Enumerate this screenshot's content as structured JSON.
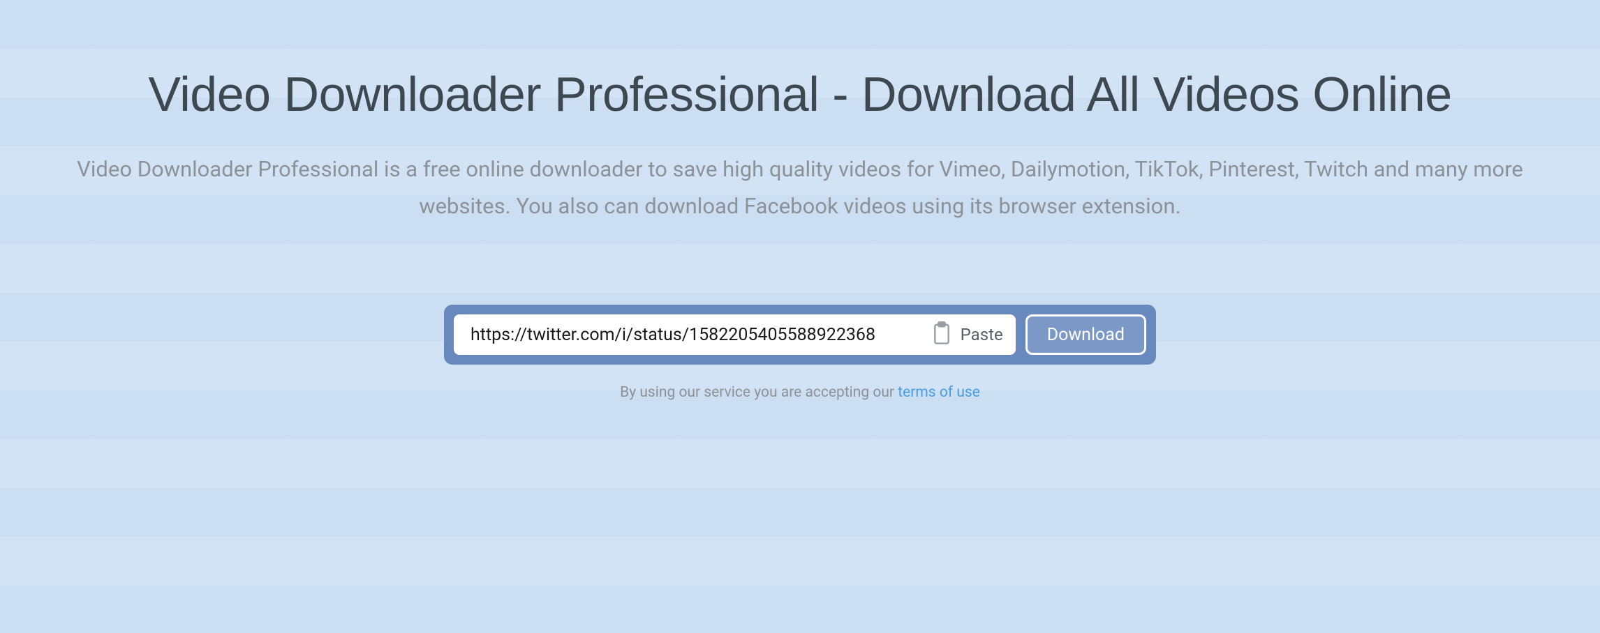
{
  "hero": {
    "title": "Video Downloader Professional - Download All Videos Online",
    "subtitle": "Video Downloader Professional is a free online downloader to save high quality videos for Vimeo, Dailymotion, TikTok, Pinterest, Twitch and many more websites. You also can download Facebook videos using its browser extension."
  },
  "form": {
    "url_value": "https://twitter.com/i/status/1582205405588922368",
    "paste_label": "Paste",
    "download_label": "Download"
  },
  "terms": {
    "prefix": "By using our service you are accepting our ",
    "link_label": "terms of use"
  }
}
